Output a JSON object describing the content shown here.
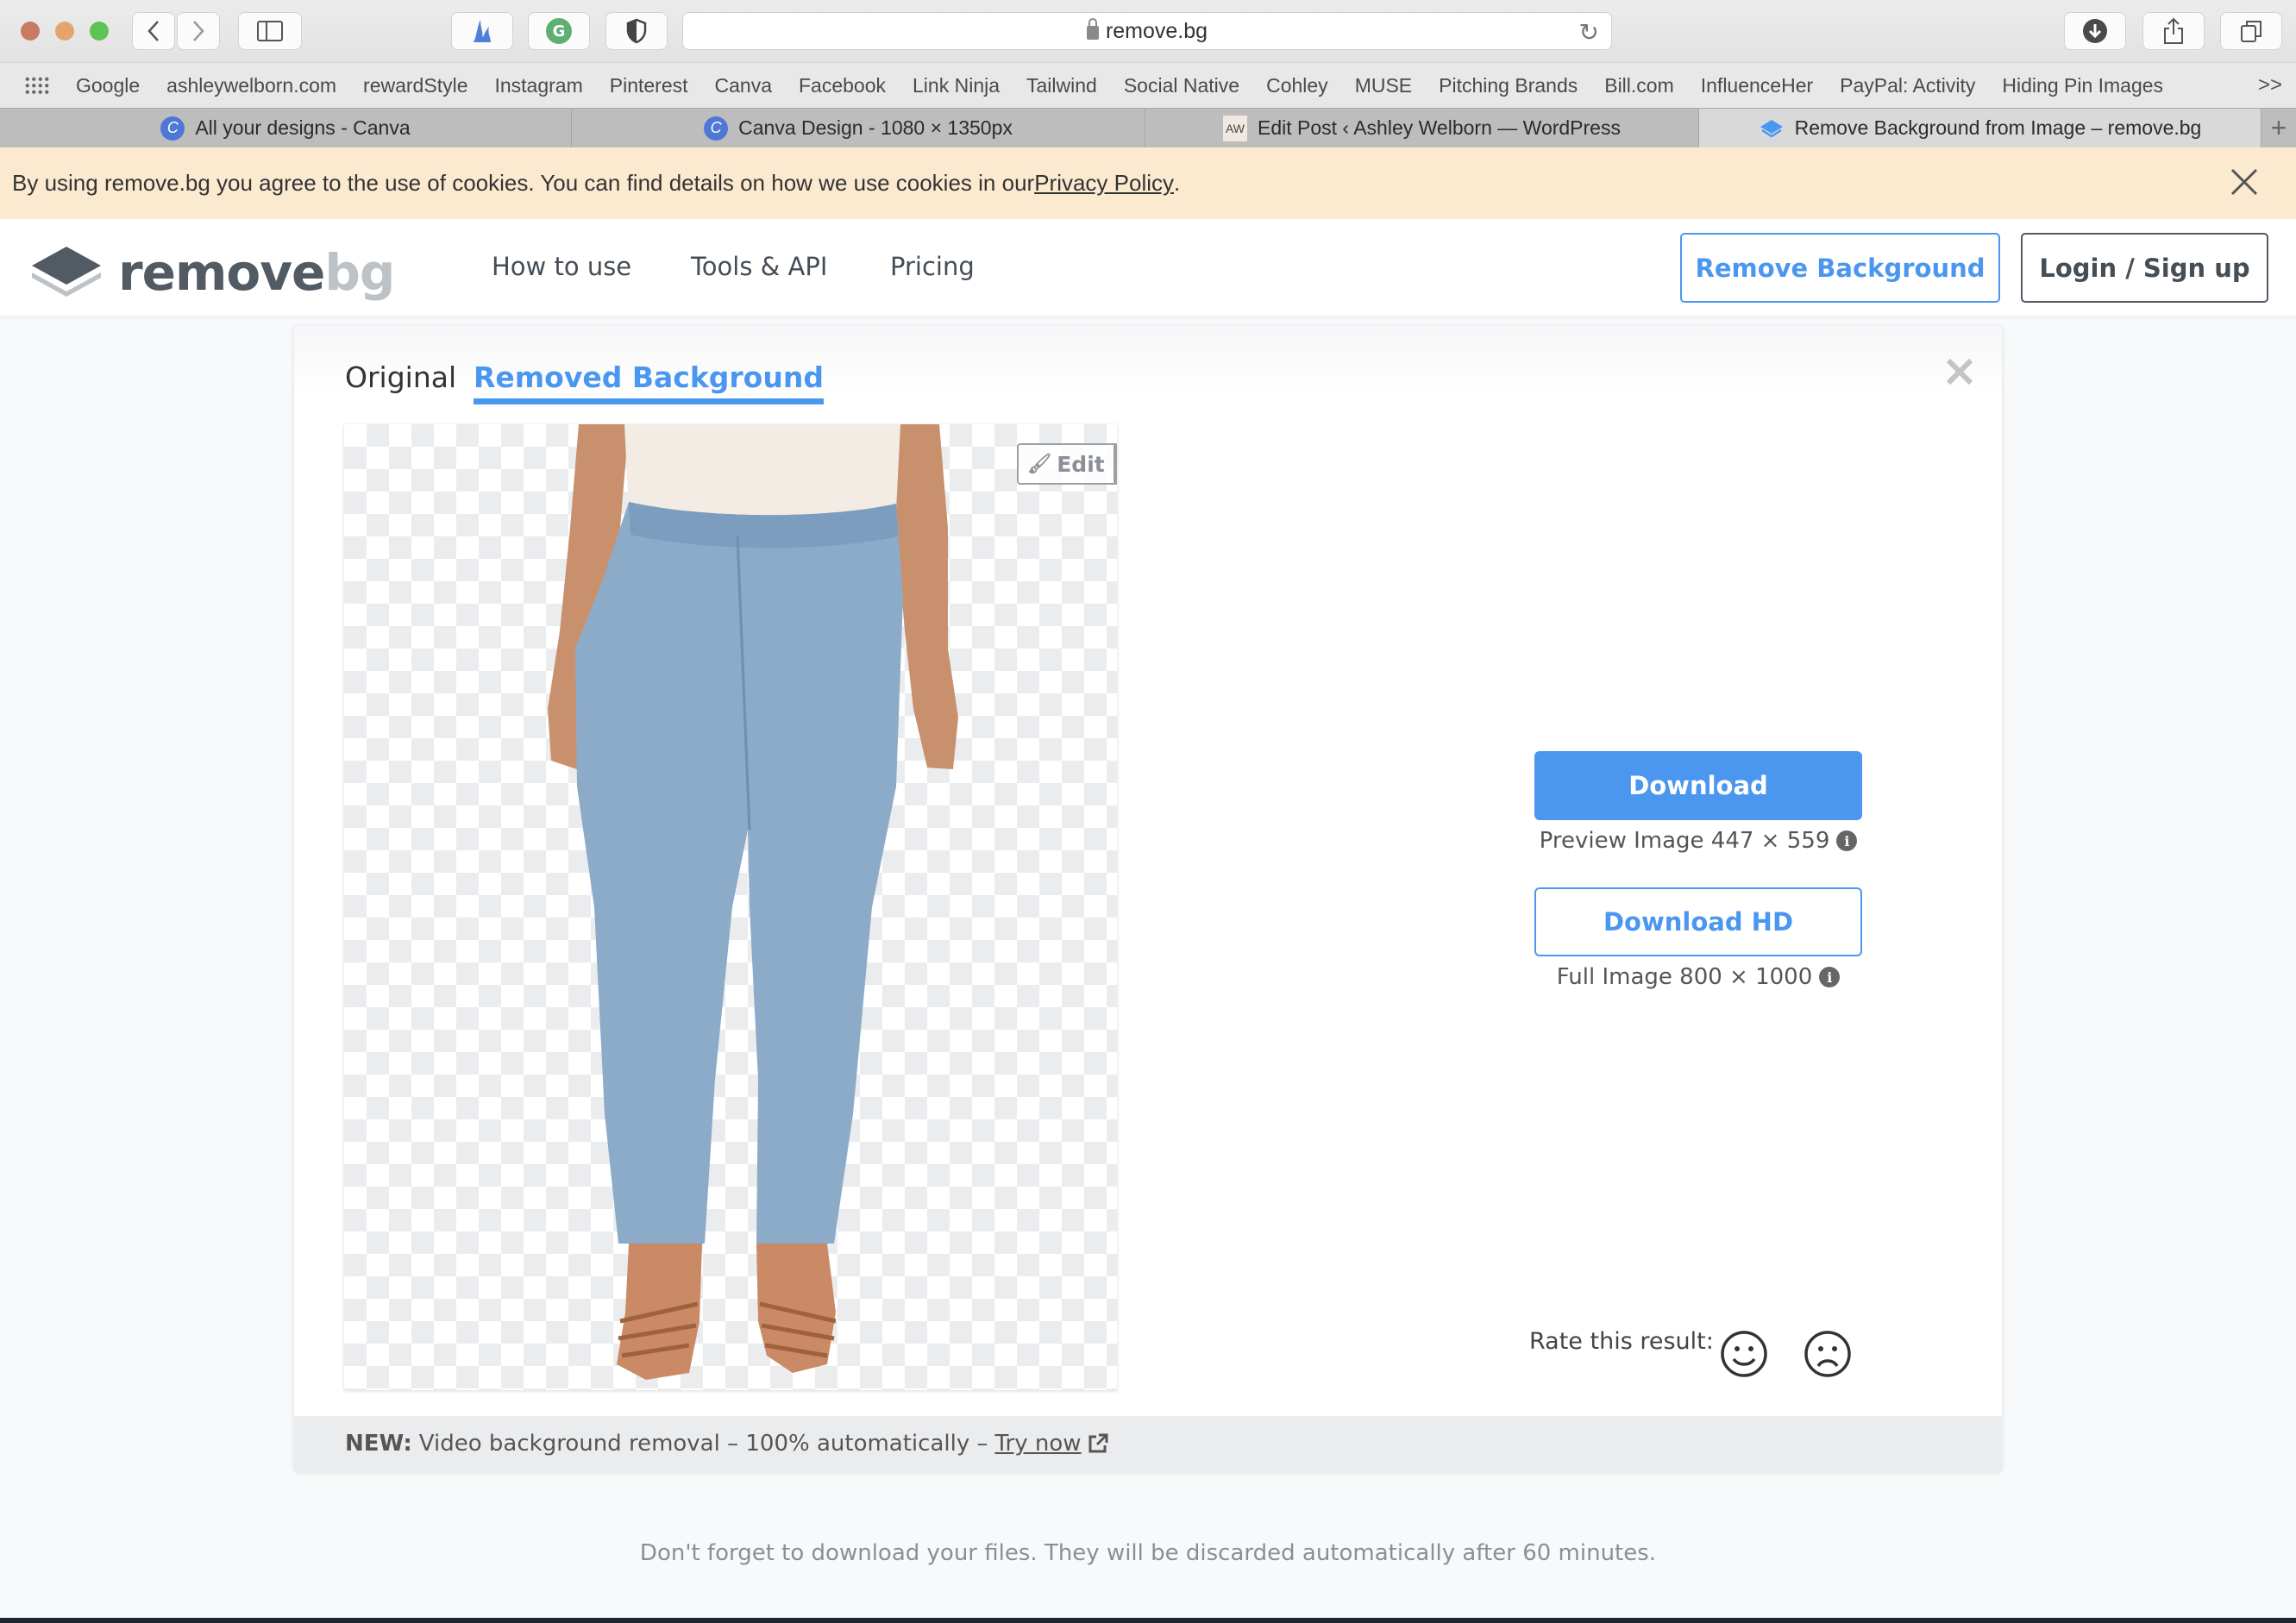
{
  "browser": {
    "url": "remove.bg",
    "bookmarks": [
      "Google",
      "ashleywelborn.com",
      "rewardStyle",
      "Instagram",
      "Pinterest",
      "Canva",
      "Facebook",
      "Link Ninja",
      "Tailwind",
      "Social Native",
      "Cohley",
      "MUSE",
      "Pitching Brands",
      "Bill.com",
      "InfluenceHer",
      "PayPal: Activity",
      "Hiding Pin Images"
    ],
    "bookmarks_more": ">>",
    "tabs": [
      {
        "title": "All your designs - Canva",
        "icon": "canva-icon",
        "active": false
      },
      {
        "title": "Canva Design - 1080 × 1350px",
        "icon": "canva-icon",
        "active": false
      },
      {
        "title": "Edit Post ‹ Ashley Welborn — WordPress",
        "icon": "aw-logo-icon",
        "active": false
      },
      {
        "title": "Remove Background from Image – remove.bg",
        "icon": "removebg-icon",
        "active": true
      }
    ],
    "new_tab": "+"
  },
  "cookie_banner": {
    "text": "By using remove.bg you agree to the use of cookies. You can find details on how we use cookies in our ",
    "link": "Privacy Policy",
    "suffix": "."
  },
  "nav": {
    "logo_part1": "remove",
    "logo_part2": "bg",
    "links": [
      "How to use",
      "Tools & API",
      "Pricing"
    ],
    "cta_primary": "Remove Background",
    "cta_secondary": "Login / Sign up"
  },
  "result": {
    "tabs": {
      "original": "Original",
      "removed": "Removed Background"
    },
    "edit_label": "Edit",
    "download_label": "Download",
    "preview_caption": "Preview Image 447 × 559",
    "download_hd_label": "Download HD",
    "full_caption": "Full Image 800 × 1000",
    "rate_label": "Rate this result:",
    "new_label": "NEW:",
    "new_text": "Video background removal – 100% automatically –",
    "new_link": "Try now"
  },
  "bottom_note": "Don't forget to download your files. They will be discarded automatically after 60 minutes.",
  "colors": {
    "accent": "#4b97f0",
    "cookie_bg": "#fbead0",
    "logo_dark": "#525a63",
    "logo_light": "#bdc2c6"
  }
}
